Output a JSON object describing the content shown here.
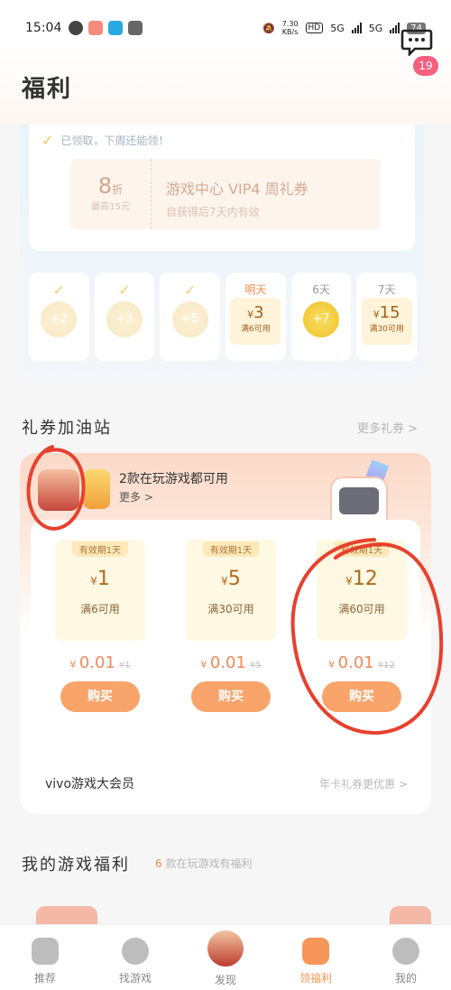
{
  "status_bar": {
    "time": "15:04",
    "net_speed": "7.30",
    "net_unit": "KB/s",
    "hd": "HD",
    "sig1": "5G",
    "sig2": "5G",
    "battery": "74"
  },
  "header": {
    "title": "福利",
    "message_badge": "19"
  },
  "checkin": {
    "note": "已领取，下周还能领！",
    "coupon": {
      "discount": "8",
      "discount_unit": "折",
      "cap": "最高15元",
      "name": "游戏中心 VIP4 周礼券",
      "desc": "自获得后7天内有效"
    },
    "days": [
      {
        "label": "",
        "reward": "+2",
        "claimed": true
      },
      {
        "label": "",
        "reward": "+3",
        "claimed": true
      },
      {
        "label": "",
        "reward": "+5",
        "claimed": true
      },
      {
        "label": "明天",
        "amount": "3",
        "cond": "满6可用"
      },
      {
        "label": "6天",
        "reward": "+7"
      },
      {
        "label": "7天",
        "amount": "15",
        "cond": "满30可用"
      }
    ]
  },
  "station": {
    "title": "礼券加油站",
    "more": "更多礼券 >",
    "message": "2款在玩游戏都可用",
    "message_more": "更多 >",
    "vouchers": [
      {
        "valid": "有效期1天",
        "amount": "1",
        "cond": "满6可用",
        "price": "0.01",
        "orig": "¥1",
        "buy": "购买"
      },
      {
        "valid": "有效期1天",
        "amount": "5",
        "cond": "满30可用",
        "price": "0.01",
        "orig": "¥5",
        "buy": "购买"
      },
      {
        "valid": "有效期1天",
        "amount": "12",
        "cond": "满60可用",
        "price": "0.01",
        "orig": "¥12",
        "buy": "购买"
      }
    ],
    "member": {
      "label": "vivo游戏大会员",
      "promo": "年卡礼券更优惠 >"
    }
  },
  "welfare": {
    "title": "我的游戏福利",
    "count": "6",
    "sub": "款在玩游戏有福利"
  },
  "nav": [
    {
      "label": "推荐",
      "active": false
    },
    {
      "label": "找游戏",
      "active": false
    },
    {
      "label": "发现",
      "active": false
    },
    {
      "label": "领福利",
      "active": true
    },
    {
      "label": "我的",
      "active": false
    }
  ],
  "colors": {
    "accent": "#f6965a",
    "annotation": "#e8402e",
    "badge": "#f65f7f"
  }
}
